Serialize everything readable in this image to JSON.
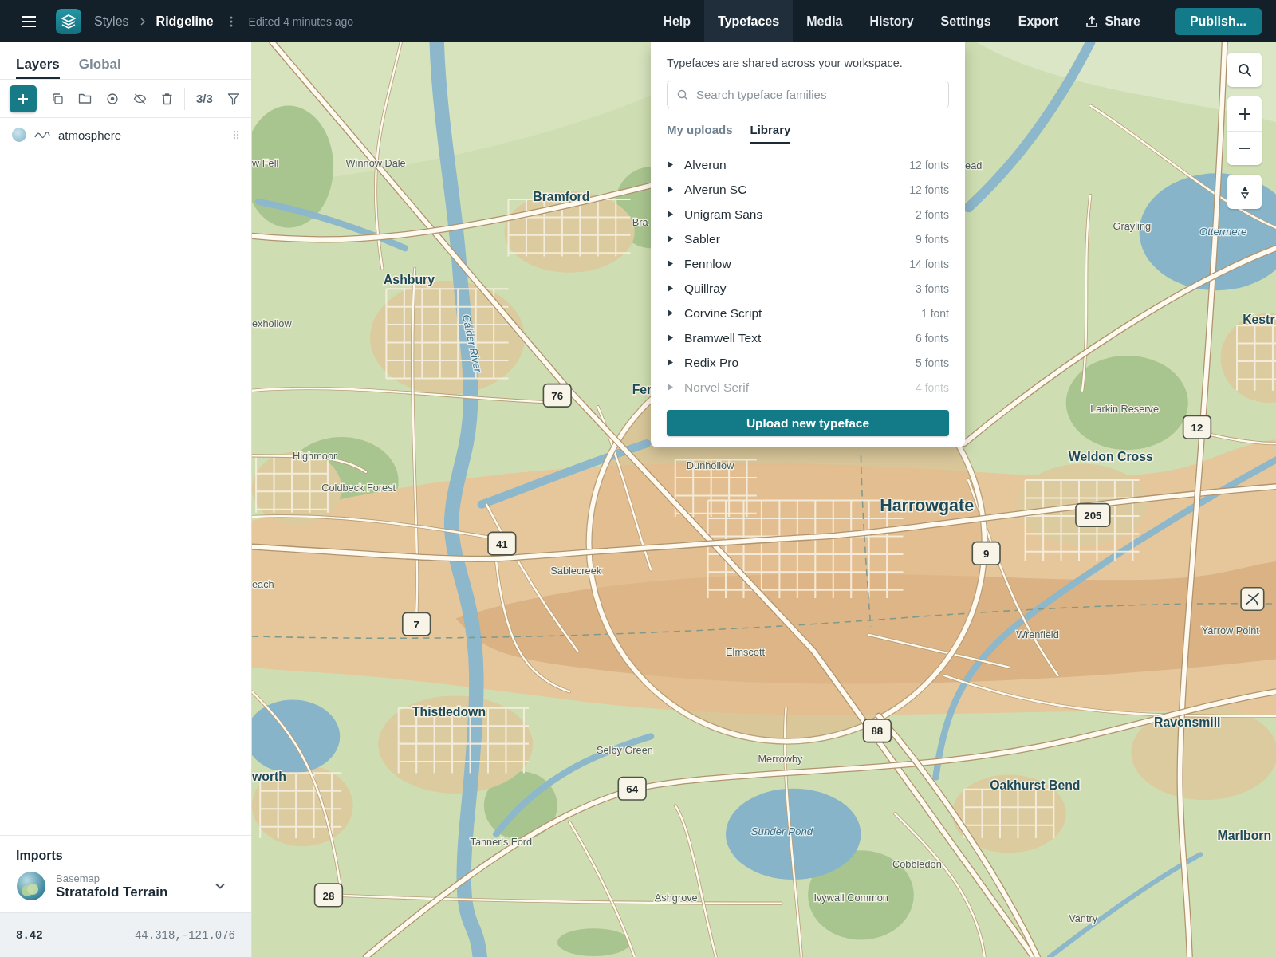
{
  "topbar": {
    "breadcrumb": [
      "Styles",
      "Ridgeline"
    ],
    "status": "Edited 4 minutes ago",
    "menu": [
      {
        "label": "Help",
        "selected": false
      },
      {
        "label": "Typefaces",
        "selected": true
      },
      {
        "label": "Media",
        "selected": false
      },
      {
        "label": "History",
        "selected": false
      },
      {
        "label": "Settings",
        "selected": false
      },
      {
        "label": "Export",
        "selected": false
      }
    ],
    "share": "Share",
    "publish": "Publish..."
  },
  "sidebar": {
    "tabs": [
      {
        "label": "Layers",
        "selected": true
      },
      {
        "label": "Global",
        "selected": false
      }
    ],
    "layer_count": "3/3",
    "layers": [
      {
        "name": "atmosphere"
      }
    ],
    "imports": {
      "title": "Imports",
      "caption": "Basemap",
      "name": "Stratafold Terrain"
    },
    "status_bar": {
      "zoom": "8.42",
      "coordinates": "44.318,-121.076"
    }
  },
  "typefaces_panel": {
    "note": "Typefaces are shared across your workspace.",
    "search": {
      "placeholder": "Search typeface families"
    },
    "tabs": [
      {
        "label": "My uploads",
        "selected": false
      },
      {
        "label": "Library",
        "selected": true
      }
    ],
    "families": [
      {
        "name": "Alverun",
        "count": "12 fonts"
      },
      {
        "name": "Alverun SC",
        "count": "12 fonts"
      },
      {
        "name": "Unigram Sans",
        "count": "2 fonts"
      },
      {
        "name": "Sabler",
        "count": "9 fonts"
      },
      {
        "name": "Fennlow",
        "count": "14 fonts"
      },
      {
        "name": "Quillray",
        "count": "3 fonts"
      },
      {
        "name": "Corvine Script",
        "count": "1 font"
      },
      {
        "name": "Bramwell Text",
        "count": "6 fonts"
      },
      {
        "name": "Redix Pro",
        "count": "5 fonts"
      },
      {
        "name": "Norvel Serif",
        "count": "4 fonts"
      }
    ],
    "upload_button": "Upload new typeface"
  },
  "map": {
    "labels": [
      {
        "text": "w Fell",
        "kind": "place"
      },
      {
        "text": "Winnow Dale",
        "kind": "place"
      },
      {
        "text": "Bramford",
        "kind": "town"
      },
      {
        "text": "Bra",
        "kind": "place"
      },
      {
        "text": "Ashbury",
        "kind": "town"
      },
      {
        "text": "Calder River",
        "kind": "river"
      },
      {
        "text": "exhollow",
        "kind": "place"
      },
      {
        "text": "Fer",
        "kind": "town"
      },
      {
        "text": "Highmoor",
        "kind": "place"
      },
      {
        "text": "Coldbeck Forest",
        "kind": "place"
      },
      {
        "text": "Dunhollow",
        "kind": "place"
      },
      {
        "text": "Sablecreek",
        "kind": "place"
      },
      {
        "text": "each",
        "kind": "place"
      },
      {
        "text": "Harrowgate",
        "kind": "city"
      },
      {
        "text": "Larkin Reserve",
        "kind": "place"
      },
      {
        "text": "Weldon Cross",
        "kind": "town"
      },
      {
        "text": "Kestr",
        "kind": "town"
      },
      {
        "text": "Grayling",
        "kind": "place"
      },
      {
        "text": "Ottermere",
        "kind": "water"
      },
      {
        "text": "ead",
        "kind": "place"
      },
      {
        "text": "Wrenfield",
        "kind": "place"
      },
      {
        "text": "Yarrow Point",
        "kind": "place"
      },
      {
        "text": "Elmscott",
        "kind": "place"
      },
      {
        "text": "Thistledown",
        "kind": "town"
      },
      {
        "text": "Ravensmill",
        "kind": "town"
      },
      {
        "text": "Selby Green",
        "kind": "place"
      },
      {
        "text": "Merrowby",
        "kind": "place"
      },
      {
        "text": "worth",
        "kind": "town"
      },
      {
        "text": "Oakhurst Bend",
        "kind": "town"
      },
      {
        "text": "Sunder Pond",
        "kind": "water"
      },
      {
        "text": "Marlborn",
        "kind": "town"
      },
      {
        "text": "Tanner's Ford",
        "kind": "place"
      },
      {
        "text": "Cobbledon",
        "kind": "place"
      },
      {
        "text": "Ashgrove",
        "kind": "place"
      },
      {
        "text": "Ivywall Common",
        "kind": "place"
      },
      {
        "text": "Vantry",
        "kind": "place"
      }
    ],
    "shields": [
      "76",
      "41",
      "7",
      "9",
      "205",
      "12",
      "88",
      "64",
      "28"
    ]
  }
}
